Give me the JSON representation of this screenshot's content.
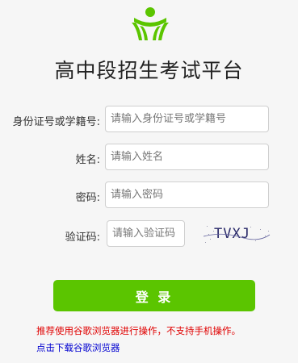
{
  "app": {
    "title": "高中段招生考试平台",
    "logo_icon": "green-sprout-logo-icon",
    "accent_color": "#5bc500"
  },
  "form": {
    "id_label": "身份证号或学籍号:",
    "id_placeholder": "请输入身份证号或学籍号",
    "name_label": "姓名:",
    "name_placeholder": "请输入姓名",
    "password_label": "密码:",
    "password_placeholder": "请输入密码",
    "captcha_label": "验证码:",
    "captcha_placeholder": "请输入验证码",
    "captcha_text": "TVXJ"
  },
  "actions": {
    "login_label": "登 录"
  },
  "footer": {
    "notice": "推荐使用谷歌浏览器进行操作，不支持手机操作。",
    "download_link": "点击下载谷歌浏览器",
    "notice_color": "#e00000",
    "link_color": "#0000d0"
  }
}
